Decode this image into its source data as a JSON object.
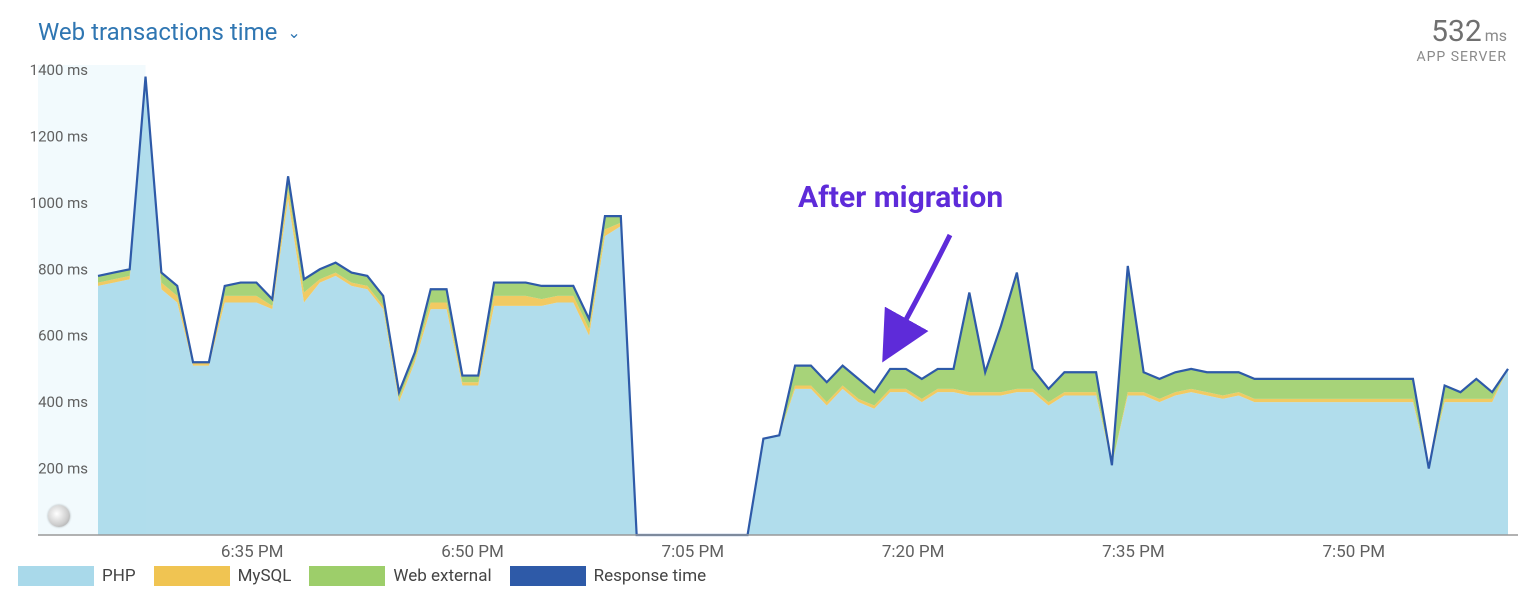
{
  "header": {
    "title": "Web transactions time",
    "metric_value": "532",
    "metric_unit": "ms",
    "metric_sub": "APP SERVER"
  },
  "annotation": {
    "label": "After migration"
  },
  "legend": {
    "items": [
      {
        "label": "PHP",
        "color": "#a9d9ea"
      },
      {
        "label": "MySQL",
        "color": "#f0c452"
      },
      {
        "label": "Web external",
        "color": "#9dce6a"
      },
      {
        "label": "Response time",
        "color": "#2e5aa8"
      }
    ]
  },
  "chart_data": {
    "type": "area",
    "title": "Web transactions time",
    "ylabel": "ms",
    "ylim": [
      0,
      1400
    ],
    "y_ticks": [
      200,
      400,
      600,
      800,
      1000,
      1200,
      1400
    ],
    "x_ticks": [
      "6:35 PM",
      "6:50 PM",
      "7:05 PM",
      "7:20 PM",
      "7:35 PM",
      "7:50 PM"
    ],
    "x": [
      0,
      1,
      2,
      3,
      4,
      5,
      6,
      7,
      8,
      9,
      10,
      11,
      12,
      13,
      14,
      15,
      16,
      17,
      18,
      19,
      20,
      21,
      22,
      23,
      24,
      25,
      26,
      27,
      28,
      29,
      30,
      31,
      32,
      33,
      34,
      35,
      36,
      37,
      38,
      39,
      40,
      41,
      42,
      43,
      44,
      45,
      46,
      47,
      48,
      49,
      50,
      51,
      52,
      53,
      54,
      55,
      56,
      57,
      58,
      59,
      60,
      61,
      62,
      63,
      64,
      65,
      66,
      67,
      68,
      69,
      70,
      71,
      72,
      73,
      74,
      75,
      76,
      77,
      78,
      79,
      80,
      81,
      82,
      83,
      84,
      85,
      86,
      87,
      88,
      89
    ],
    "series": [
      {
        "name": "PHP",
        "color": "#a9d9ea",
        "values": [
          750,
          760,
          770,
          1380,
          740,
          700,
          510,
          510,
          700,
          700,
          700,
          680,
          1010,
          700,
          760,
          780,
          750,
          740,
          680,
          400,
          520,
          680,
          680,
          450,
          450,
          690,
          690,
          690,
          690,
          700,
          700,
          600,
          900,
          930,
          0,
          0,
          0,
          0,
          0,
          0,
          0,
          0,
          290,
          300,
          440,
          440,
          390,
          440,
          400,
          380,
          430,
          430,
          400,
          430,
          430,
          420,
          420,
          420,
          430,
          430,
          390,
          420,
          420,
          420,
          210,
          420,
          420,
          400,
          420,
          430,
          420,
          410,
          420,
          400,
          400,
          400,
          400,
          400,
          400,
          400,
          400,
          400,
          400,
          400,
          200,
          400,
          400,
          400,
          400,
          500
        ]
      },
      {
        "name": "MySQL",
        "color": "#f0c452",
        "values": [
          10,
          10,
          10,
          0,
          20,
          20,
          10,
          10,
          20,
          20,
          20,
          10,
          30,
          30,
          10,
          10,
          10,
          10,
          10,
          10,
          10,
          20,
          20,
          10,
          10,
          30,
          30,
          30,
          20,
          20,
          20,
          20,
          20,
          10,
          0,
          0,
          0,
          0,
          0,
          0,
          0,
          0,
          0,
          0,
          10,
          10,
          10,
          10,
          10,
          10,
          10,
          10,
          10,
          10,
          10,
          10,
          10,
          10,
          10,
          10,
          10,
          10,
          10,
          10,
          0,
          10,
          10,
          10,
          10,
          10,
          10,
          10,
          10,
          10,
          10,
          10,
          10,
          10,
          10,
          10,
          10,
          10,
          10,
          10,
          0,
          10,
          10,
          10,
          10,
          0
        ]
      },
      {
        "name": "Web external",
        "color": "#9dce6a",
        "values": [
          20,
          20,
          20,
          0,
          30,
          30,
          0,
          0,
          30,
          40,
          40,
          20,
          40,
          40,
          30,
          30,
          30,
          30,
          30,
          20,
          20,
          40,
          40,
          20,
          20,
          40,
          40,
          40,
          40,
          30,
          30,
          30,
          40,
          20,
          0,
          0,
          0,
          0,
          0,
          0,
          0,
          0,
          0,
          0,
          60,
          60,
          60,
          60,
          60,
          40,
          60,
          60,
          60,
          60,
          60,
          300,
          60,
          200,
          350,
          60,
          40,
          60,
          60,
          60,
          0,
          380,
          60,
          60,
          60,
          60,
          60,
          70,
          60,
          60,
          60,
          60,
          60,
          60,
          60,
          60,
          60,
          60,
          60,
          60,
          0,
          40,
          20,
          60,
          20,
          0
        ]
      }
    ],
    "response_time": [
      780,
      790,
      800,
      1380,
      790,
      750,
      520,
      520,
      750,
      760,
      760,
      710,
      1080,
      770,
      800,
      820,
      790,
      780,
      720,
      430,
      550,
      740,
      740,
      480,
      480,
      760,
      760,
      760,
      750,
      750,
      750,
      650,
      960,
      960,
      0,
      0,
      0,
      0,
      0,
      0,
      0,
      0,
      290,
      300,
      510,
      510,
      460,
      510,
      470,
      430,
      500,
      500,
      470,
      500,
      500,
      730,
      490,
      630,
      790,
      500,
      440,
      490,
      490,
      490,
      210,
      810,
      490,
      470,
      490,
      500,
      490,
      490,
      490,
      470,
      470,
      470,
      470,
      470,
      470,
      470,
      470,
      470,
      470,
      470,
      200,
      450,
      430,
      470,
      430,
      500
    ]
  }
}
